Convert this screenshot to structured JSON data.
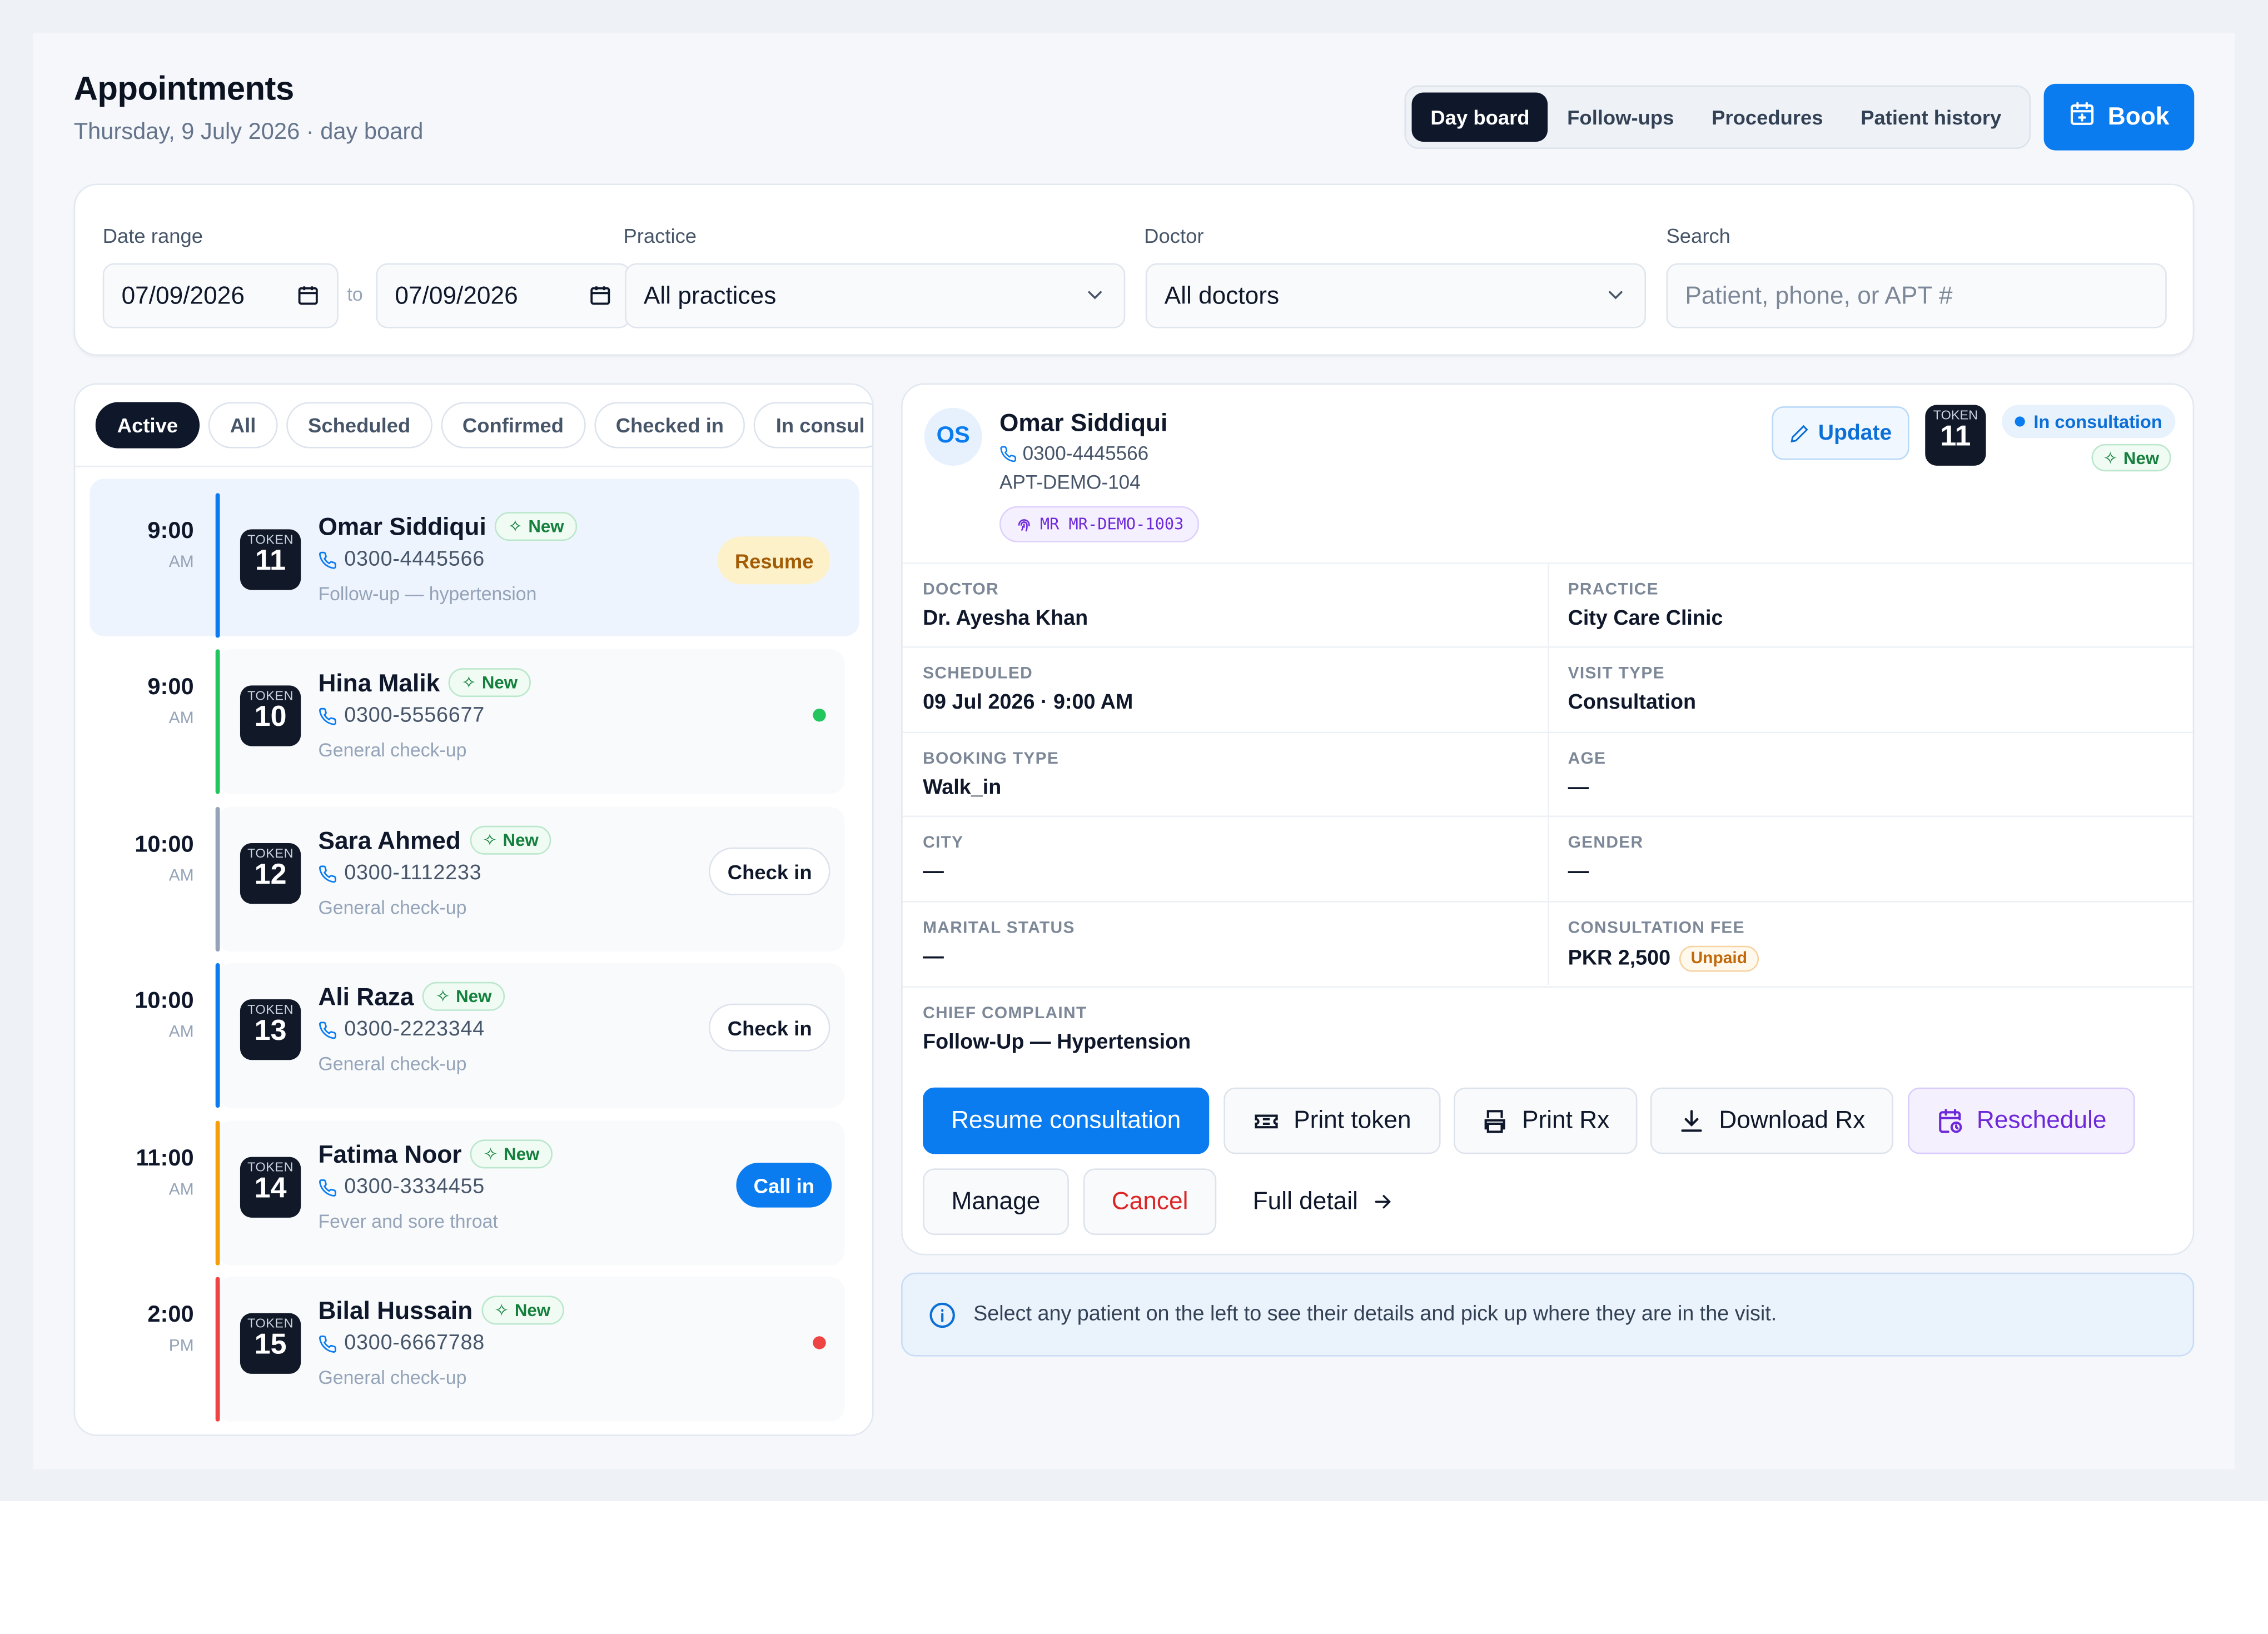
{
  "header": {
    "title": "Appointments",
    "subtitle": "Thursday, 9 July 2026 · day board",
    "views": [
      "Day board",
      "Follow-ups",
      "Procedures",
      "Patient history"
    ],
    "active_view": "Day board",
    "book_label": "Book"
  },
  "filters": {
    "date_range_label": "Date range",
    "date_from": "07/09/2026",
    "to_label": "to",
    "date_to": "07/09/2026",
    "practice_label": "Practice",
    "practice_value": "All practices",
    "doctor_label": "Doctor",
    "doctor_value": "All doctors",
    "search_label": "Search",
    "search_placeholder": "Patient, phone, or APT #"
  },
  "status_tabs": [
    "Active",
    "All",
    "Scheduled",
    "Confirmed",
    "Checked in",
    "In consul"
  ],
  "token_label": "TOKEN",
  "new_label": "New",
  "colors": {
    "accent": "#0b7cf0",
    "dark": "#0f172a",
    "success": "#22c55e",
    "danger": "#ef4444",
    "warning": "#f59e0b",
    "muted": "#94a3b8"
  },
  "appointments": [
    {
      "time": "9:00",
      "ampm": "AM",
      "token": "11",
      "name": "Omar Siddiqui",
      "phone": "0300-4445566",
      "reason": "Follow-up — hypertension",
      "action": "Resume",
      "bar_color": "#0b7cf0",
      "selected": true
    },
    {
      "time": "9:00",
      "ampm": "AM",
      "token": "10",
      "name": "Hina Malik",
      "phone": "0300-5556677",
      "reason": "General check-up",
      "action": "",
      "bar_color": "#22c55e",
      "dot_color": "#22c55e"
    },
    {
      "time": "10:00",
      "ampm": "AM",
      "token": "12",
      "name": "Sara Ahmed",
      "phone": "0300-1112233",
      "reason": "General check-up",
      "action": "Check in",
      "bar_color": "#94a3b8"
    },
    {
      "time": "10:00",
      "ampm": "AM",
      "token": "13",
      "name": "Ali Raza",
      "phone": "0300-2223344",
      "reason": "General check-up",
      "action": "Check in",
      "bar_color": "#0b7cf0"
    },
    {
      "time": "11:00",
      "ampm": "AM",
      "token": "14",
      "name": "Fatima Noor",
      "phone": "0300-3334455",
      "reason": "Fever and sore throat",
      "action": "Call in",
      "bar_color": "#f59e0b"
    },
    {
      "time": "2:00",
      "ampm": "PM",
      "token": "15",
      "name": "Bilal Hussain",
      "phone": "0300-6667788",
      "reason": "General check-up",
      "action": "",
      "bar_color": "#ef4444",
      "dot_color": "#ef4444"
    }
  ],
  "detail": {
    "initials": "OS",
    "name": "Omar Siddiqui",
    "phone": "0300-4445566",
    "apt": "APT-DEMO-104",
    "mr": "MR MR-DEMO-1003",
    "update_label": "Update",
    "token": "11",
    "status": "In consultation",
    "fields": [
      {
        "key": "Doctor",
        "value": "Dr. Ayesha Khan"
      },
      {
        "key": "Practice",
        "value": "City Care Clinic"
      },
      {
        "key": "Scheduled",
        "value": "09 Jul 2026 · 9:00 AM"
      },
      {
        "key": "Visit type",
        "value": "Consultation"
      },
      {
        "key": "Booking type",
        "value": "Walk_in"
      },
      {
        "key": "Age",
        "value": "—"
      },
      {
        "key": "City",
        "value": "—"
      },
      {
        "key": "Gender",
        "value": "—"
      },
      {
        "key": "Marital status",
        "value": "—"
      },
      {
        "key": "Consultation fee",
        "value": "PKR 2,500"
      }
    ],
    "fee_status": "Unpaid",
    "chief_complaint_label": "Chief complaint",
    "chief_complaint": "Follow-Up — Hypertension",
    "actions": {
      "resume": "Resume consultation",
      "print_token": "Print token",
      "print_rx": "Print Rx",
      "download_rx": "Download Rx",
      "reschedule": "Reschedule",
      "manage": "Manage",
      "cancel": "Cancel",
      "full_detail": "Full detail"
    }
  },
  "info_text": "Select any patient on the left to see their details and pick up where they are in the visit."
}
